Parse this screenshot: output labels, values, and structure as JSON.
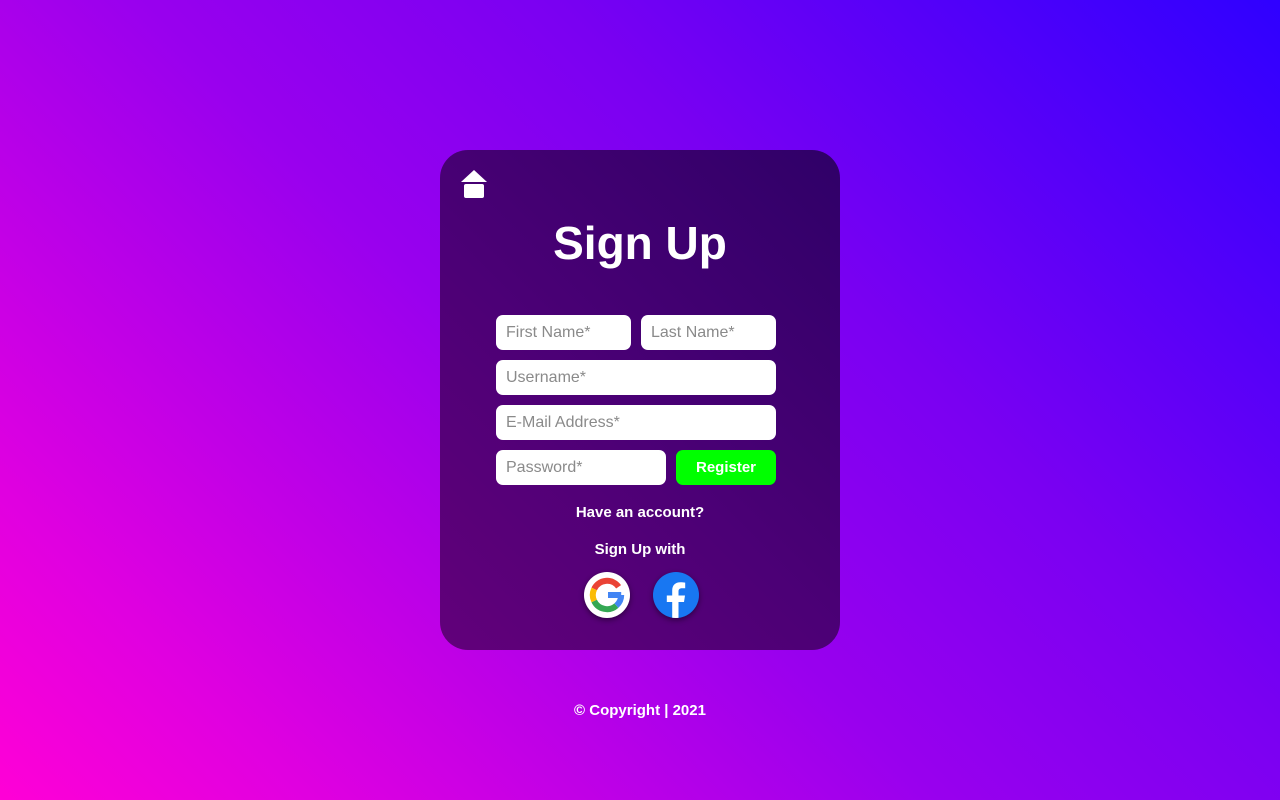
{
  "home": {
    "icon": "home-icon"
  },
  "form": {
    "title": "Sign Up",
    "first_name_placeholder": "First Name*",
    "last_name_placeholder": "Last Name*",
    "username_placeholder": "Username*",
    "email_placeholder": "E-Mail Address*",
    "password_placeholder": "Password*",
    "register_label": "Register",
    "have_account_label": "Have an account?",
    "sign_up_with_label": "Sign Up with"
  },
  "social": [
    {
      "icon": "google-icon"
    },
    {
      "icon": "facebook-icon"
    }
  ],
  "footer": {
    "copyright": "© Copyright | 2021"
  },
  "colors": {
    "register_button": "#00ff00",
    "facebook_blue": "#1877f2",
    "card": "#4c0076"
  }
}
